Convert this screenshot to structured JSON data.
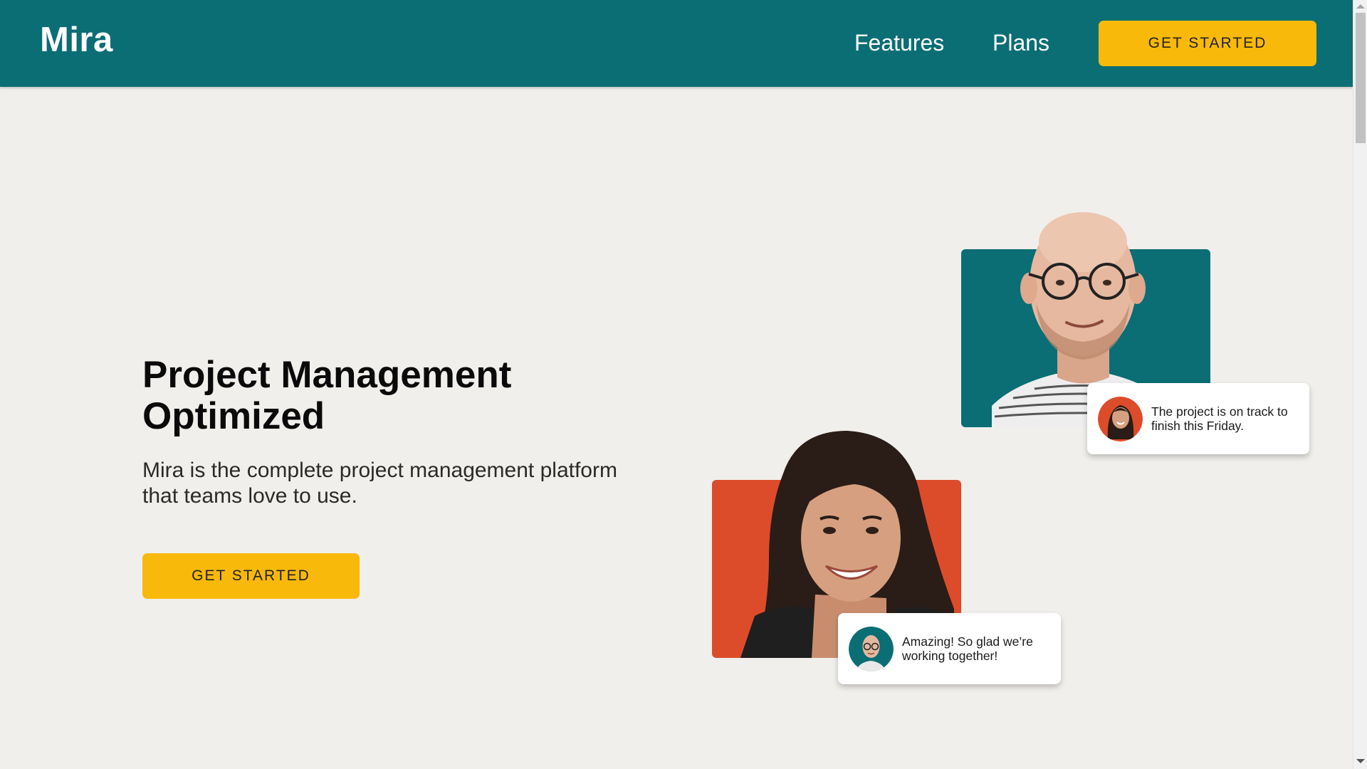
{
  "header": {
    "logo": "Mira",
    "nav": [
      {
        "label": "Features"
      },
      {
        "label": "Plans"
      }
    ],
    "cta_label": "GET STARTED"
  },
  "hero": {
    "title": "Project Management Optimized",
    "subtitle": "Mira is the complete project management platform that teams love to use.",
    "cta_label": "GET STARTED"
  },
  "testimonials": [
    {
      "text": "The project is on track to finish this Friday.",
      "avatar": "woman-avatar",
      "card_color": "#0a6e74"
    },
    {
      "text": "Amazing! So glad we’re working together!",
      "avatar": "man-avatar",
      "card_color": "#dc4c2b"
    }
  ],
  "colors": {
    "header_bg": "#0a6e74",
    "accent": "#f9b90a",
    "page_bg": "#f1efeb",
    "card_teal": "#0a6e74",
    "card_orange": "#dc4c2b"
  },
  "icons": [
    "man-portrait",
    "woman-portrait",
    "woman-avatar",
    "man-avatar"
  ]
}
